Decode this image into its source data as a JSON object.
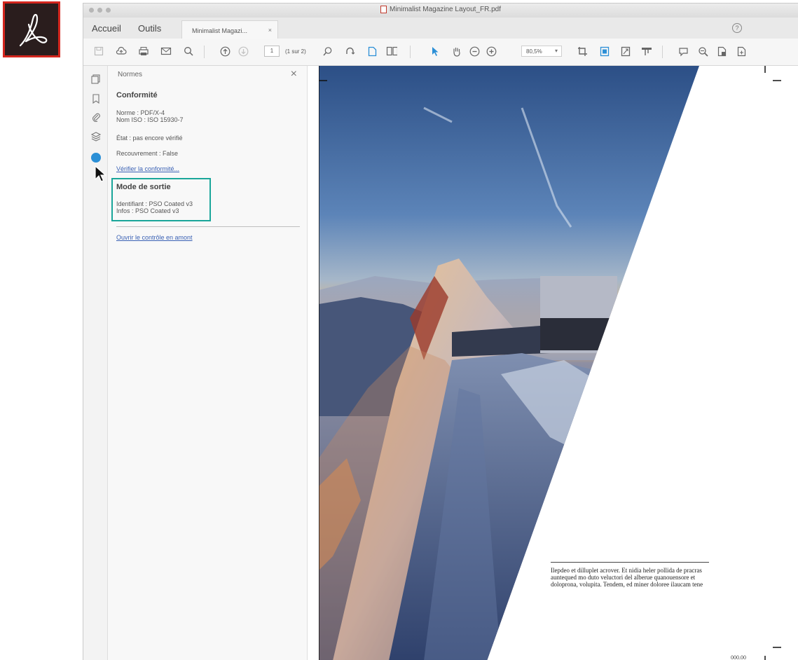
{
  "window": {
    "title": "Minimalist Magazine Layout_FR.pdf"
  },
  "menu": {
    "home": "Accueil",
    "tools": "Outils"
  },
  "tab": {
    "label": "Minimalist Magazi...",
    "close": "×"
  },
  "toolbar": {
    "page_current": "1",
    "page_total": "(1 sur 2)",
    "zoom": "80,5%"
  },
  "panel": {
    "title": "Normes",
    "close": "×",
    "conformity_heading": "Conformité",
    "norm_line": "Norme : PDF/X-4\nNom ISO : ISO 15930-7",
    "state_line": "État : pas encore vérifié",
    "overprint_line": "Recouvrement : False",
    "verify_link": "Vérifier la conformité...",
    "output_heading": "Mode de sortie",
    "output_line": "Identifiant : PSO Coated v3\nInfos : PSO Coated v3",
    "profile_link": "Ouvrir le contrôle en amont"
  },
  "document": {
    "caption": "Ilepdeo et dilluplet acrover. Et nidia heler pollida de pracras auntequed mo duto veluctori del alberue quanouensore et doloprona, volupita. Tendem, ed miner doloree ilaucam tene",
    "footer": "000.00"
  },
  "colors": {
    "accent": "#1aa69a",
    "link": "#3a61b4",
    "logo_red": "#d3261e"
  }
}
